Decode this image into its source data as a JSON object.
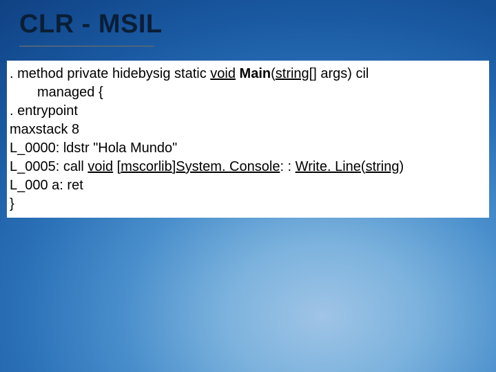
{
  "slide": {
    "title": "CLR - MSIL"
  },
  "code": {
    "l1_a": ". method private hidebysig static ",
    "l1_void": "void",
    "l1_sp1": " ",
    "l1_main": "Main",
    "l1_paren": "(",
    "l1_string": "string",
    "l1_brackets": "[]",
    "l1_b": " args) cil",
    "l2": "managed {",
    "l3": ". entrypoint",
    "l4": "maxstack 8",
    "l5": "L_0000: ldstr \"Hola Mundo\"",
    "l6_a": "L_0005: call ",
    "l6_void": "void",
    "l6_sp1": " [",
    "l6_mscorlib": "mscorlib",
    "l6_b": "]",
    "l6_sysconsole": "System. Console",
    "l6_c": ": : ",
    "l6_writeline": "Write. Line",
    "l6_paren": "(",
    "l6_string": "string",
    "l6_close": ")",
    "l7": "L_000 a: ret",
    "l8": "}"
  }
}
